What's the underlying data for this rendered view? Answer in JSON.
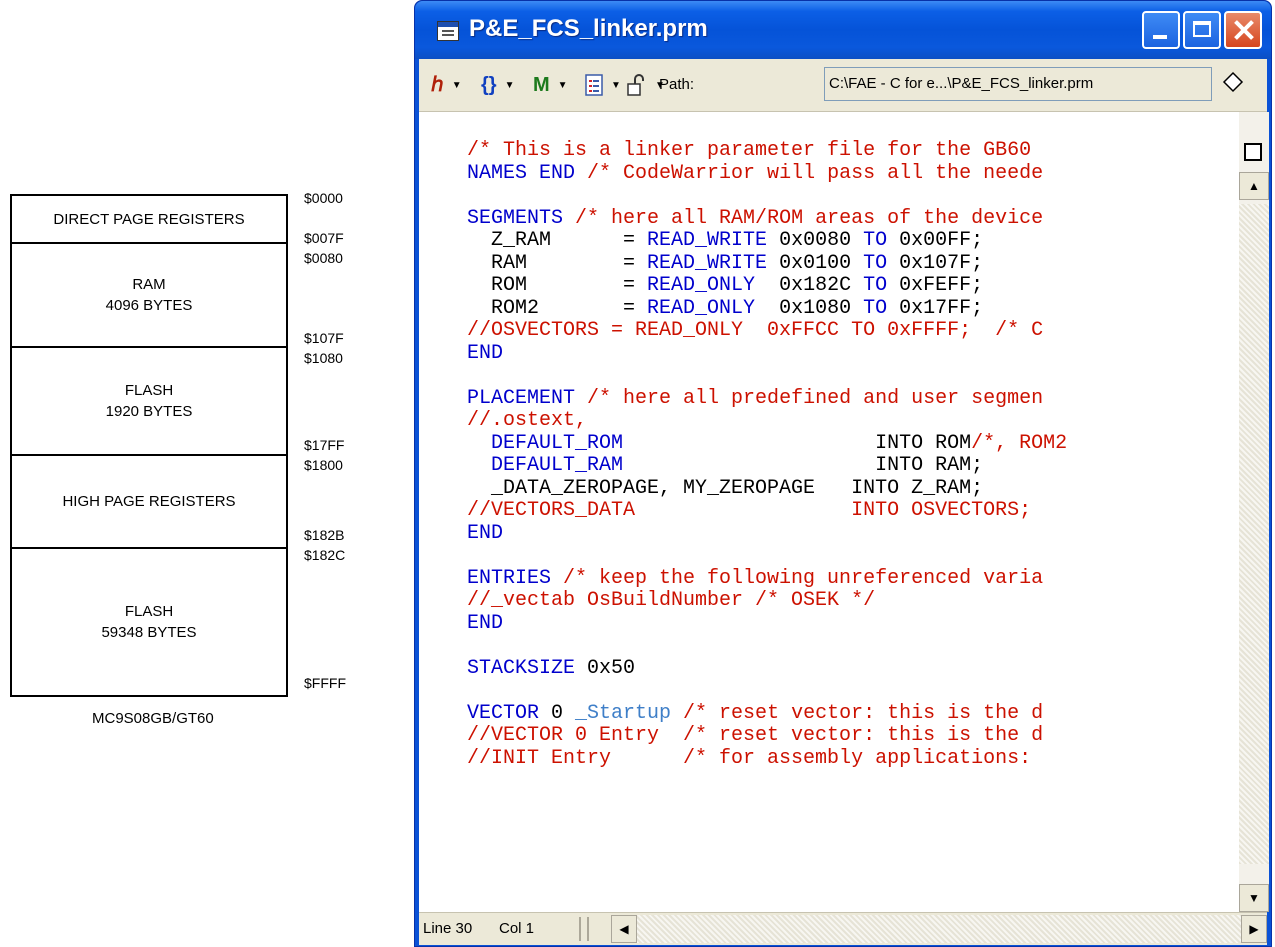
{
  "memory_map": {
    "blocks": [
      {
        "name": "DIRECT PAGE REGISTERS",
        "size": ""
      },
      {
        "name": "RAM",
        "size": "4096 BYTES"
      },
      {
        "name": "FLASH",
        "size": "1920 BYTES"
      },
      {
        "name": "HIGH PAGE REGISTERS",
        "size": ""
      },
      {
        "name": "FLASH",
        "size": "59348 BYTES"
      }
    ],
    "addresses": [
      "$0000",
      "$007F",
      "$0080",
      "$107F",
      "$1080",
      "$17FF",
      "$1800",
      "$182B",
      "$182C",
      "$FFFF"
    ],
    "caption": "MC9S08GB/GT60"
  },
  "window": {
    "title": "P&E_FCS_linker.prm",
    "toolbar": {
      "path_label": "Path:",
      "path_value": "C:\\FAE - C for e...\\P&E_FCS_linker.prm"
    },
    "code_lines": [
      [
        [
          "/* This is a linker parameter file for the GB60 ",
          "r"
        ]
      ],
      [
        [
          "NAMES END ",
          "b"
        ],
        [
          "/* CodeWarrior will pass all the neede",
          "r"
        ]
      ],
      [
        [
          "",
          "k"
        ]
      ],
      [
        [
          "SEGMENTS ",
          "b"
        ],
        [
          "/* here all RAM/ROM areas of the device",
          "r"
        ]
      ],
      [
        [
          "  Z_RAM      = ",
          "k"
        ],
        [
          "READ_WRITE",
          "b"
        ],
        [
          " 0x0080 ",
          "k"
        ],
        [
          "TO",
          "b"
        ],
        [
          " 0x00FF;",
          "k"
        ]
      ],
      [
        [
          "  RAM        = ",
          "k"
        ],
        [
          "READ_WRITE",
          "b"
        ],
        [
          " 0x0100 ",
          "k"
        ],
        [
          "TO",
          "b"
        ],
        [
          " 0x107F;",
          "k"
        ]
      ],
      [
        [
          "  ROM        = ",
          "k"
        ],
        [
          "READ_ONLY",
          "b"
        ],
        [
          "  0x182C ",
          "k"
        ],
        [
          "TO",
          "b"
        ],
        [
          " 0xFEFF;",
          "k"
        ]
      ],
      [
        [
          "  ROM2       = ",
          "k"
        ],
        [
          "READ_ONLY",
          "b"
        ],
        [
          "  0x1080 ",
          "k"
        ],
        [
          "TO",
          "b"
        ],
        [
          " 0x17FF;",
          "k"
        ]
      ],
      [
        [
          "//OSVECTORS = READ_ONLY  0xFFCC TO 0xFFFF;  /* C",
          "r"
        ]
      ],
      [
        [
          "END",
          "b"
        ]
      ],
      [
        [
          "",
          "k"
        ]
      ],
      [
        [
          "PLACEMENT ",
          "b"
        ],
        [
          "/* here all predefined and user segmen",
          "r"
        ]
      ],
      [
        [
          "//.ostext,",
          "r"
        ]
      ],
      [
        [
          "  DEFAULT_ROM",
          "b"
        ],
        [
          "                     INTO ROM",
          "k"
        ],
        [
          "/*, ROM2",
          "r"
        ]
      ],
      [
        [
          "  DEFAULT_RAM",
          "b"
        ],
        [
          "                     INTO RAM;",
          "k"
        ]
      ],
      [
        [
          "  _DATA_ZEROPAGE, MY_ZEROPAGE   INTO Z_RAM;",
          "k"
        ]
      ],
      [
        [
          "//VECTORS_DATA                  INTO OSVECTORS;",
          "r"
        ]
      ],
      [
        [
          "END",
          "b"
        ]
      ],
      [
        [
          "",
          "k"
        ]
      ],
      [
        [
          "ENTRIES ",
          "b"
        ],
        [
          "/* keep the following unreferenced varia",
          "r"
        ]
      ],
      [
        [
          "//_vectab OsBuildNumber /* OSEK */",
          "r"
        ]
      ],
      [
        [
          "END",
          "b"
        ]
      ],
      [
        [
          "",
          "k"
        ]
      ],
      [
        [
          "STACKSIZE ",
          "b"
        ],
        [
          "0x50",
          "k"
        ]
      ],
      [
        [
          "",
          "k"
        ]
      ],
      [
        [
          "VECTOR ",
          "b"
        ],
        [
          "0 ",
          "k"
        ],
        [
          "_Startup",
          "l"
        ],
        [
          " /* reset vector: this is the d",
          "r"
        ]
      ],
      [
        [
          "//VECTOR 0 Entry  /* reset vector: this is the d",
          "r"
        ]
      ],
      [
        [
          "//INIT Entry      /* for assembly applications: ",
          "r"
        ]
      ]
    ],
    "status": {
      "line": "Line 30",
      "col": "Col 1"
    }
  }
}
